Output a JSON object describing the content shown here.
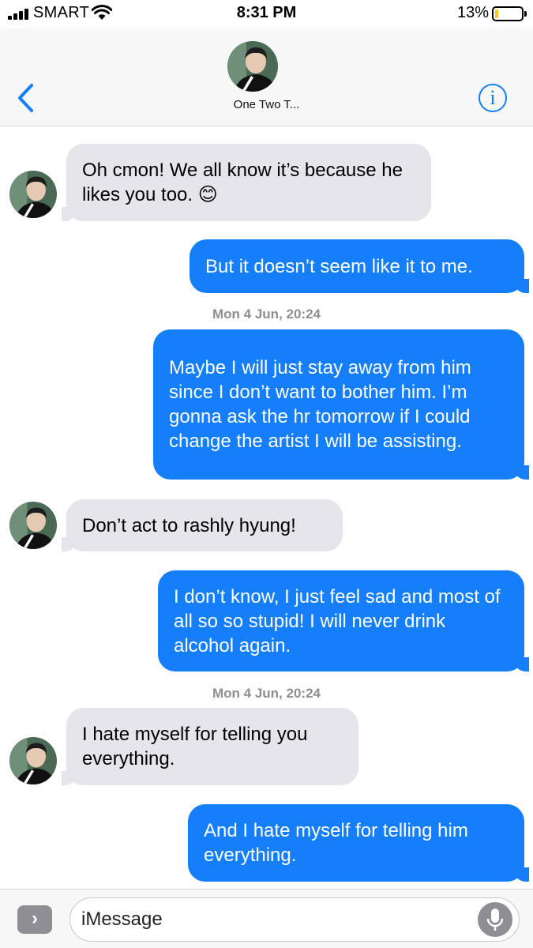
{
  "status_bar": {
    "carrier": "SMART",
    "time": "8:31 PM",
    "battery_percent": "13%",
    "battery_level": 0.13,
    "battery_color": "#f6c81b"
  },
  "nav": {
    "contact_name": "One Two T...",
    "info_glyph": "i",
    "back_icon": "chevron-left-icon"
  },
  "messages": [
    {
      "direction": "incoming",
      "text": "Oh cmon! We all know it’s because he likes you too. 😊"
    },
    {
      "direction": "outgoing",
      "text": "But it doesn’t seem like it to me."
    },
    {
      "direction": "timestamp",
      "text": "Mon 4 Jun, 20:24"
    },
    {
      "direction": "outgoing",
      "text": "Maybe I will just stay away from him since I don’t want to bother him. I’m gonna ask the hr tomorrow if I could change the artist I will be assisting."
    },
    {
      "direction": "incoming",
      "text": "Don’t act to rashly hyung!"
    },
    {
      "direction": "outgoing",
      "text": "I don’t know, I just feel sad and most of all so so stupid! I will never drink alcohol again."
    },
    {
      "direction": "timestamp",
      "text": "Mon 4 Jun, 20:24"
    },
    {
      "direction": "incoming",
      "text": "I hate myself for telling you everything."
    },
    {
      "direction": "outgoing",
      "text": "And I hate myself for telling him everything."
    }
  ],
  "input_bar": {
    "placeholder": "iMessage",
    "apps_glyph": "›",
    "mic_icon": "microphone-icon"
  },
  "colors": {
    "outgoing_bubble": "#157efb",
    "incoming_bubble": "#e5e5ea",
    "accent": "#157efb"
  }
}
